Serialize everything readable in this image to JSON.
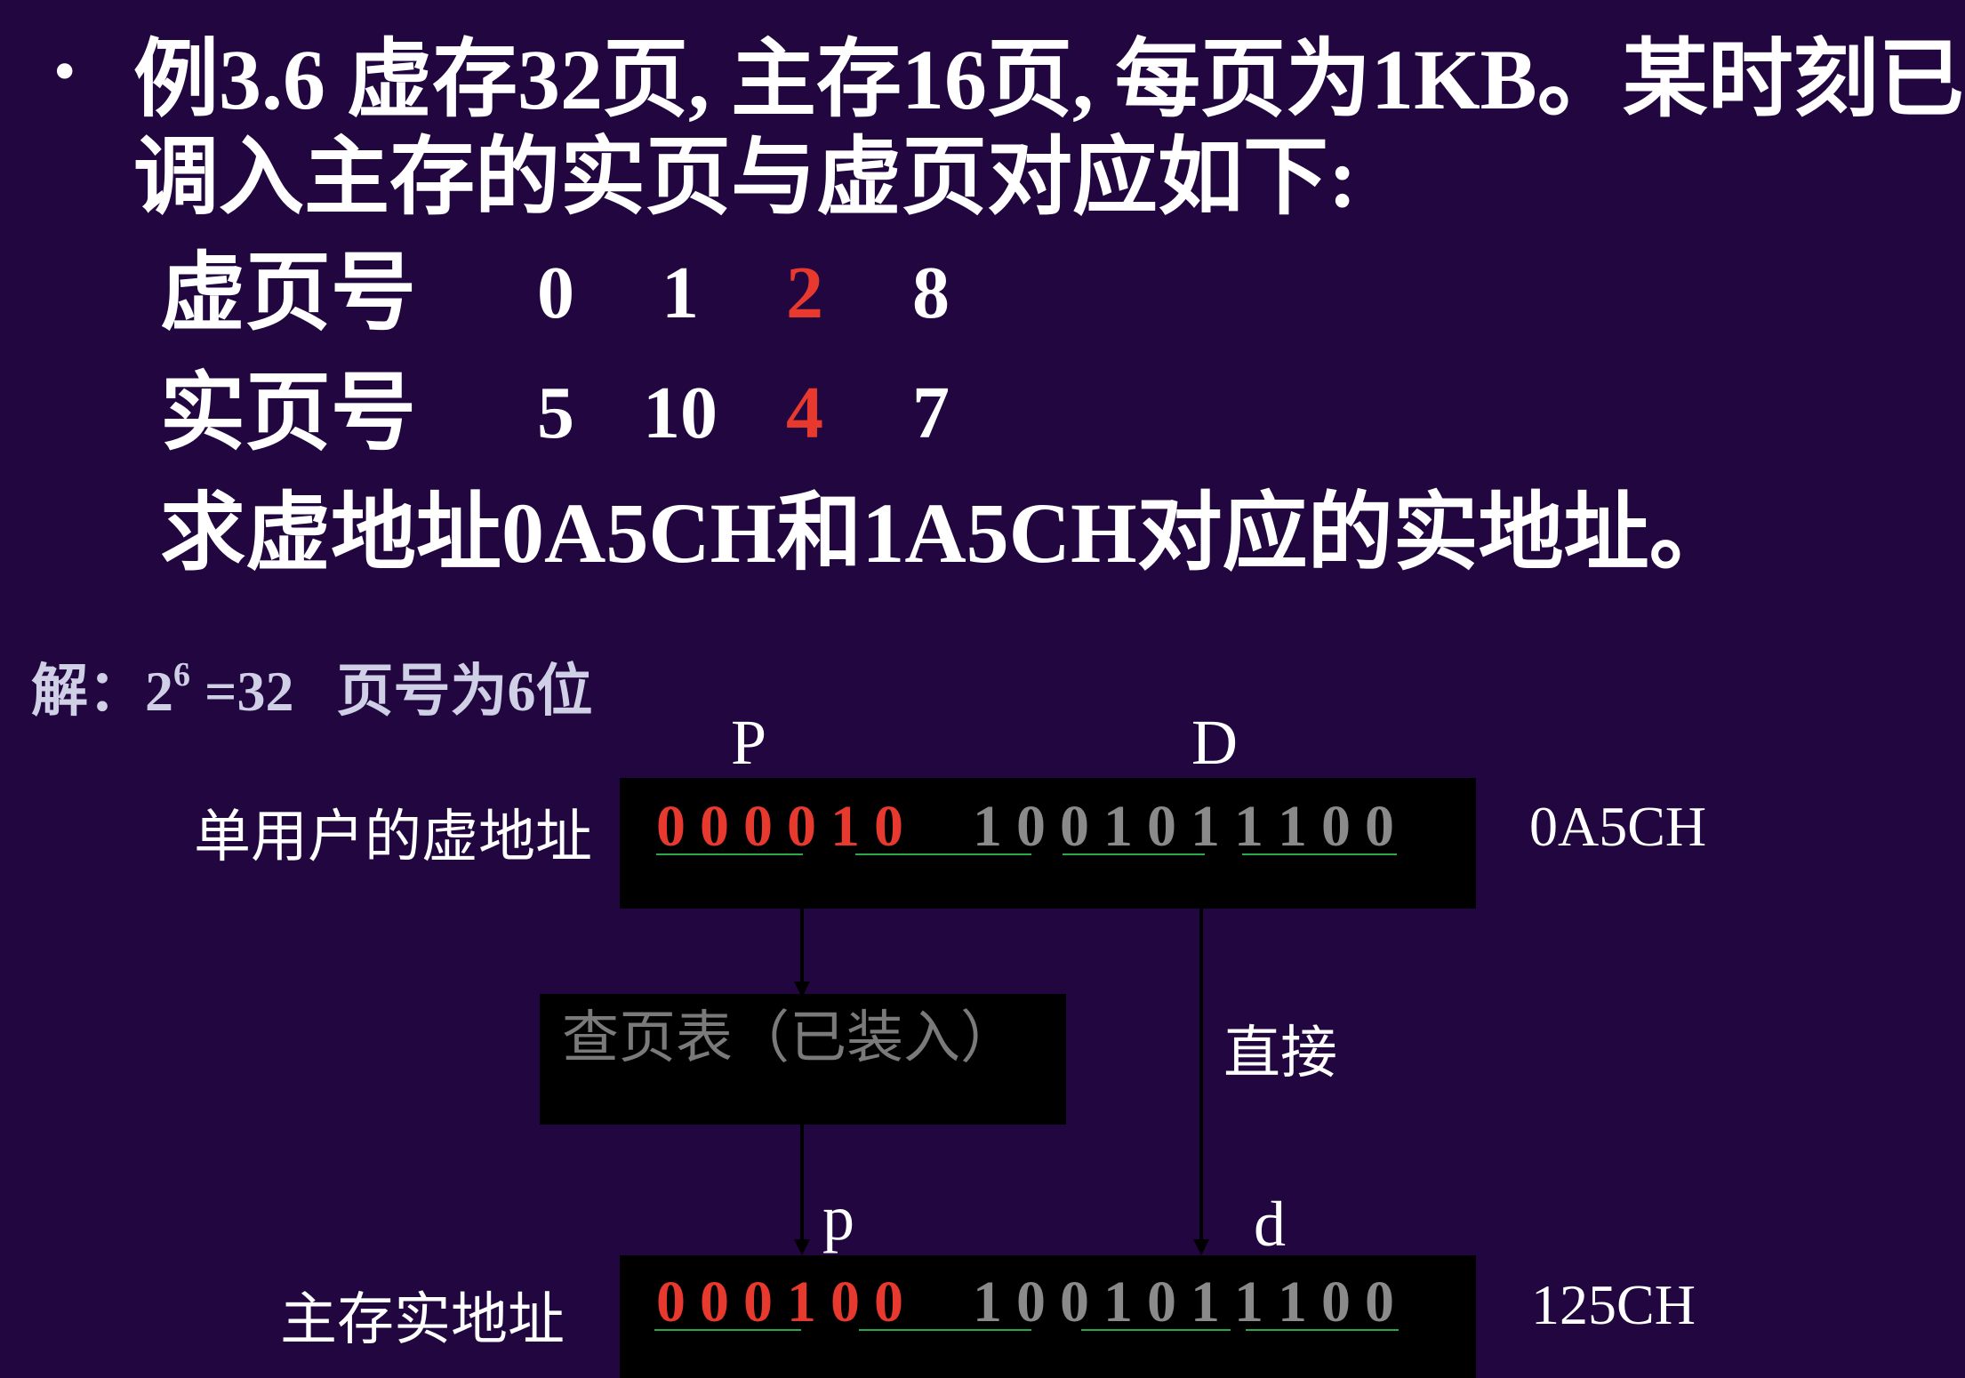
{
  "heading": {
    "bullet": "•",
    "line1": "例3.6  虚存32页, 主存16页, 每页为1KB。某时刻已",
    "line2": "调入主存的实页与虚页对应如下:"
  },
  "page_table": {
    "virtual_label": "虚页号",
    "real_label": "实页号",
    "virtual_pages": [
      "0",
      "1",
      "2",
      "8"
    ],
    "real_pages": [
      "5",
      "10",
      "4",
      "7"
    ],
    "highlight_color": "#e8392f"
  },
  "question": "求虚地址0A5CH和1A5CH对应的实地址。",
  "solution": {
    "prefix": "解：2",
    "exponent": "6",
    "suffix": " =32   页号为6位"
  },
  "diagram": {
    "p_upper": "P",
    "d_upper": "D",
    "virtual_address_label": "单用户的虚地址",
    "virtual_bits_page": [
      "0",
      "0",
      "0",
      "0",
      "1",
      "0"
    ],
    "virtual_bits_offset": [
      "1",
      "0",
      "0",
      "1",
      "0",
      "1",
      "1",
      "1",
      "0",
      "0"
    ],
    "virtual_hex": "0A5CH",
    "lookup_label": "查页表（已装入）",
    "direct_label": "直接",
    "p_lower": "p",
    "d_lower": "d",
    "real_address_label": "主存实地址",
    "real_bits_page": [
      "0",
      "0",
      "0",
      "1",
      "0",
      "0"
    ],
    "real_bits_offset": [
      "1",
      "0",
      "0",
      "1",
      "0",
      "1",
      "1",
      "1",
      "0",
      "0"
    ],
    "real_hex": "125CH"
  }
}
